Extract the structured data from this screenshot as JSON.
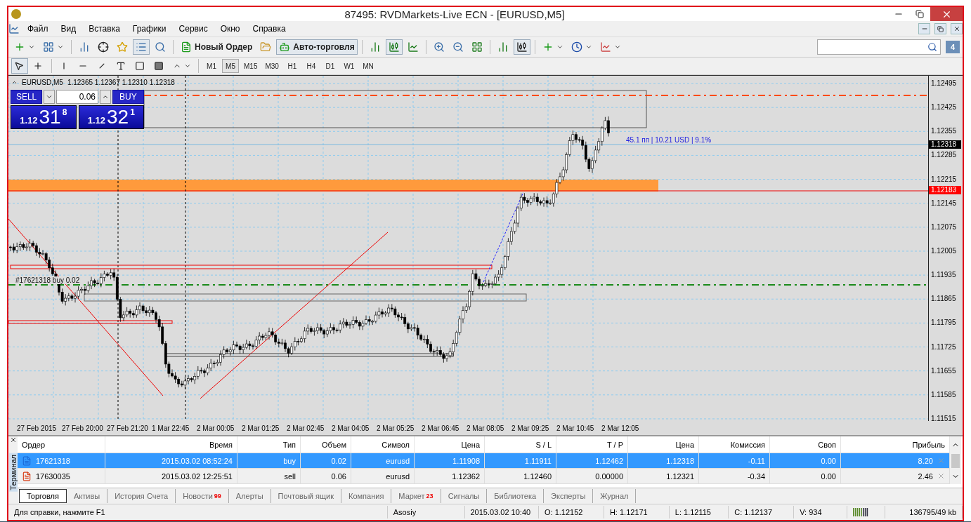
{
  "window": {
    "title": "87495: RVDMarkets-Live ECN - [EURUSD,M5]"
  },
  "menu": [
    "Файл",
    "Вид",
    "Вставка",
    "Графики",
    "Сервис",
    "Окно",
    "Справка"
  ],
  "toolbar": {
    "new_order": "Новый Ордер",
    "auto_trading": {
      "label": "Авто-торговля",
      "on": true
    }
  },
  "timeframes": [
    {
      "label": "M1",
      "selected": false
    },
    {
      "label": "M5",
      "selected": true
    },
    {
      "label": "M15",
      "selected": false
    },
    {
      "label": "M30",
      "selected": false
    },
    {
      "label": "H1",
      "selected": false
    },
    {
      "label": "H4",
      "selected": false
    },
    {
      "label": "D1",
      "selected": false
    },
    {
      "label": "W1",
      "selected": false
    },
    {
      "label": "MN",
      "selected": false
    }
  ],
  "notifications": "4",
  "chart": {
    "symbol": "EURUSD,M5",
    "ohlc": "1.12365 1.12367 1.12310 1.12318",
    "one_click": {
      "sell": "SELL",
      "buy": "BUY",
      "volume": "0.06",
      "bid": {
        "big": "1.12",
        "pips": "31",
        "point": "8"
      },
      "ask": {
        "big": "1.12",
        "pips": "32",
        "point": "1"
      }
    },
    "profit_label": "45.1 пп | 10.21 USD | 9.1%",
    "order_label": "#17621318 buy 0.02",
    "price_axis": [
      "1.12495",
      "1.12425",
      "1.12355",
      "1.12285",
      "1.12215",
      "1.12145",
      "1.12075",
      "1.12005",
      "1.11935",
      "1.11865",
      "1.11795",
      "1.11725",
      "1.11655",
      "1.11585",
      "1.11515"
    ],
    "bid_marker": "1.12318",
    "alert_marker": "1.12183",
    "time_axis": [
      "27 Feb 2015",
      "27 Feb 20:00",
      "27 Feb 21:20",
      "1 Mar 22:45",
      "2 Mar 00:05",
      "2 Mar 01:25",
      "2 Mar 02:45",
      "2 Mar 04:05",
      "2 Mar 05:25",
      "2 Mar 06:45",
      "2 Mar 08:05",
      "2 Mar 09:25",
      "2 Mar 10:45",
      "2 Mar 12:05"
    ]
  },
  "terminal": {
    "side_label": "Терминал",
    "columns": [
      "Ордер",
      "Время",
      "Тип",
      "Объем",
      "Символ",
      "Цена",
      "S / L",
      "T / P",
      "Цена",
      "Комиссия",
      "Своп",
      "Прибыль"
    ],
    "rows": [
      {
        "kind": "buy",
        "selected": true,
        "cells": [
          "17621318",
          "2015.03.02 08:52:24",
          "buy",
          "0.02",
          "eurusd",
          "1.11908",
          "1.11911",
          "1.12462",
          "1.12318",
          "-0.11",
          "0.00",
          "8.20"
        ]
      },
      {
        "kind": "sell",
        "selected": false,
        "cells": [
          "17630035",
          "2015.03.02 12:25:51",
          "sell",
          "0.06",
          "eurusd",
          "1.12362",
          "1.12460",
          "0.00000",
          "1.12321",
          "-0.34",
          "0.00",
          "2.46"
        ]
      }
    ],
    "tabs": [
      {
        "label": "Торговля",
        "selected": true
      },
      {
        "label": "Активы",
        "selected": false
      },
      {
        "label": "История Счета",
        "selected": false
      },
      {
        "label": "Новости",
        "badge": "99",
        "selected": false
      },
      {
        "label": "Алерты",
        "selected": false
      },
      {
        "label": "Почтовый ящик",
        "selected": false
      },
      {
        "label": "Компания",
        "selected": false
      },
      {
        "label": "Маркет",
        "badge": "23",
        "selected": false
      },
      {
        "label": "Сигналы",
        "selected": false
      },
      {
        "label": "Библиотека",
        "selected": false
      },
      {
        "label": "Эксперты",
        "selected": false
      },
      {
        "label": "Журнал",
        "selected": false
      }
    ]
  },
  "status_bar": [
    "Для справки, нажмите F1",
    "Asosiy",
    "2015.03.02 10:40",
    "O: 1.12152",
    "H: 1.12171",
    "L: 1.12115",
    "C: 1.12137",
    "V: 934",
    "136795/49 kb"
  ]
}
